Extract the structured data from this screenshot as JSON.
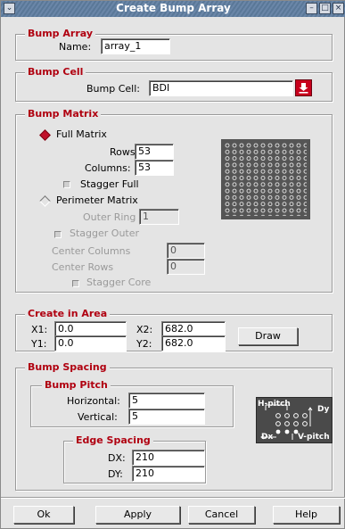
{
  "window": {
    "title": "Create Bump Array",
    "menu_glyph": "⌄",
    "min_glyph": "–",
    "max_glyph": "□",
    "close_glyph": "×"
  },
  "bump_array": {
    "legend": "Bump Array",
    "name_label": "Name:",
    "name_value": "array_1"
  },
  "bump_cell": {
    "legend": "Bump Cell",
    "cell_label": "Bump Cell:",
    "cell_value": "BDI"
  },
  "bump_matrix": {
    "legend": "Bump Matrix",
    "full_matrix_label": "Full Matrix",
    "rows_label": "Rows:",
    "rows_value": "53",
    "columns_label": "Columns:",
    "columns_value": "53",
    "stagger_full_label": "Stagger Full",
    "perimeter_matrix_label": "Perimeter Matrix",
    "outer_ring_label": "Outer Ring",
    "outer_ring_value": "1",
    "stagger_outer_label": "Stagger Outer",
    "center_columns_label": "Center Columns",
    "center_columns_value": "0",
    "center_rows_label": "Center Rows",
    "center_rows_value": "0",
    "stagger_core_label": "Stagger Core",
    "selected": "Full Matrix"
  },
  "create_in_area": {
    "legend": "Create in Area",
    "x1_label": "X1:",
    "x1_value": "0.0",
    "x2_label": "X2:",
    "x2_value": "682.0",
    "y1_label": "Y1:",
    "y1_value": "0.0",
    "y2_label": "Y2:",
    "y2_value": "682.0",
    "draw_label": "Draw"
  },
  "bump_spacing": {
    "legend": "Bump Spacing",
    "pitch_legend": "Bump Pitch",
    "horizontal_label": "Horizontal:",
    "horizontal_value": "5",
    "vertical_label": "Vertical:",
    "vertical_value": "5",
    "edge_legend": "Edge Spacing",
    "dx_label": "DX:",
    "dx_value": "210",
    "dy_label": "DY:",
    "dy_value": "210",
    "diagram": {
      "h_pitch": "H-pitch",
      "v_pitch": "V-pitch",
      "dx": "Dx",
      "dy": "Dy"
    }
  },
  "buttons": {
    "ok": "Ok",
    "apply": "Apply",
    "cancel": "Cancel",
    "help": "Help"
  },
  "colors": {
    "legend_red": "#b00010",
    "title_blue": "#6a86a8",
    "radio_on": "#c0102a"
  }
}
